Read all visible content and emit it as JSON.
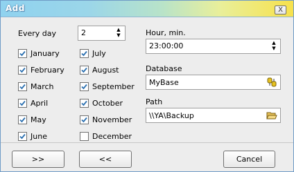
{
  "window": {
    "title": "Add",
    "close_glyph": "X"
  },
  "schedule": {
    "every_day_label": "Every day",
    "every_day_value": "2"
  },
  "months": [
    {
      "label": "January",
      "checked": true
    },
    {
      "label": "February",
      "checked": true
    },
    {
      "label": "March",
      "checked": true
    },
    {
      "label": "April",
      "checked": true
    },
    {
      "label": "May",
      "checked": true
    },
    {
      "label": "June",
      "checked": true
    },
    {
      "label": "July",
      "checked": true
    },
    {
      "label": "August",
      "checked": true
    },
    {
      "label": "September",
      "checked": true
    },
    {
      "label": "October",
      "checked": true
    },
    {
      "label": "November",
      "checked": true
    },
    {
      "label": "December",
      "checked": false
    }
  ],
  "time": {
    "label": "Hour, min.",
    "value": "23:00:00"
  },
  "database": {
    "label": "Database",
    "value": "MyBase"
  },
  "path": {
    "label": "Path",
    "value": "\\\\YA\\Backup"
  },
  "buttons": {
    "next": ">>",
    "prev": "<<",
    "cancel": "Cancel"
  },
  "colors": {
    "title_gradient_start": "#8fd2ef",
    "title_gradient_end": "#f7e14c",
    "check": "#2a6fb0"
  }
}
